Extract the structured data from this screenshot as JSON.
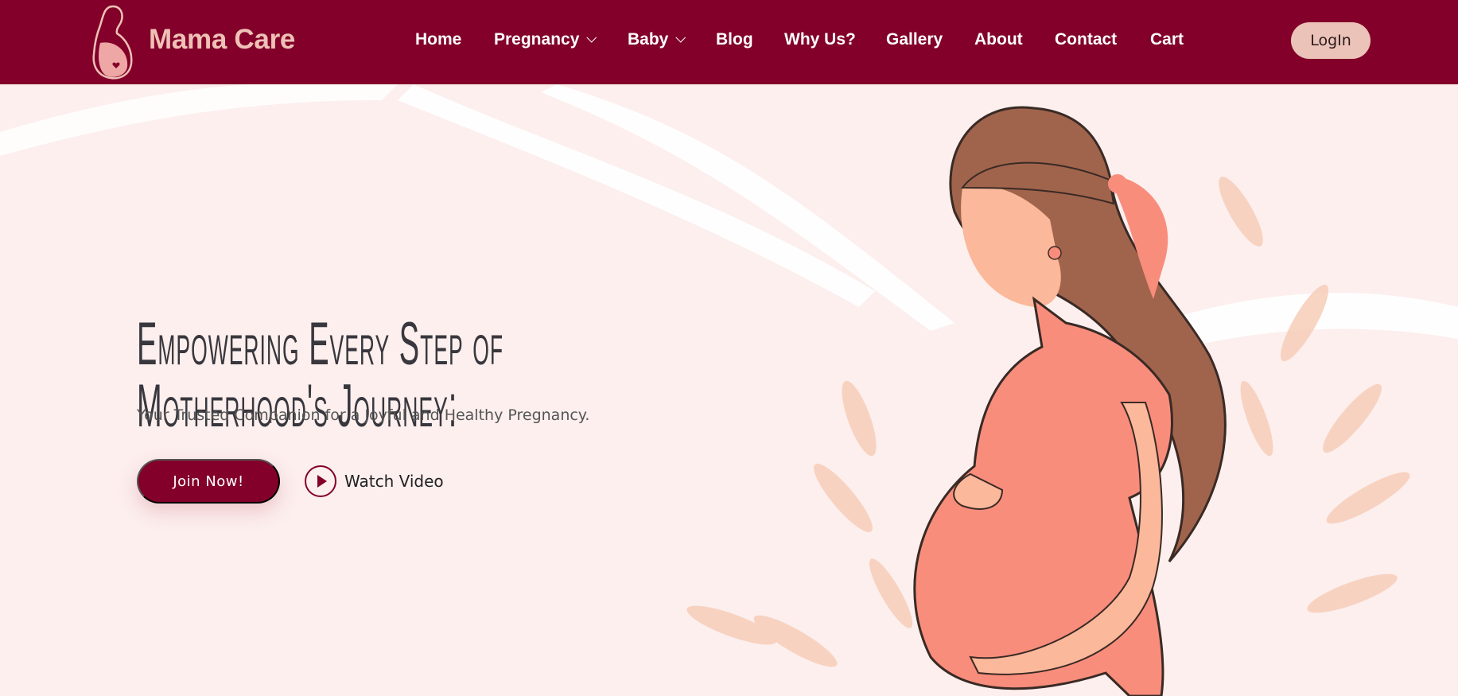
{
  "brand": {
    "name": "Mama Care"
  },
  "nav": {
    "items": [
      {
        "label": "Home"
      },
      {
        "label": "Pregnancy",
        "dropdown": true
      },
      {
        "label": "Baby",
        "dropdown": true
      },
      {
        "label": "Blog"
      },
      {
        "label": "Why Us?"
      },
      {
        "label": "Gallery"
      },
      {
        "label": "About"
      },
      {
        "label": "Contact"
      },
      {
        "label": "Cart"
      }
    ],
    "login_label": "LogIn"
  },
  "hero": {
    "heading_line1": "Empowering Every Step of",
    "heading_line2": "Motherhood's Journey:",
    "subtitle": "Your Trusted Companion for a Joyful and Healthy Pregnancy.",
    "join_label": "Join Now!",
    "watch_label": "Watch Video"
  },
  "colors": {
    "brand": "#82002a",
    "accent": "#ebc3b8",
    "background": "#fcefee",
    "dress": "#f98d7c",
    "hair": "#a0644c"
  },
  "icons": {
    "logo": "pregnant-woman-logo-icon",
    "chevron": "chevron-down-icon",
    "play": "play-circle-icon"
  }
}
